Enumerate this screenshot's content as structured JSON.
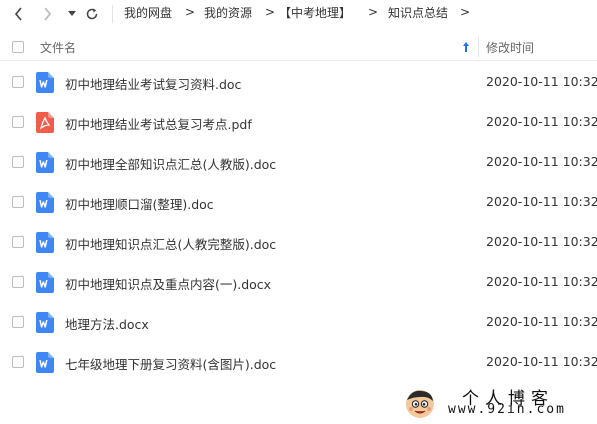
{
  "breadcrumb": {
    "items": [
      "我的网盘",
      "我的资源",
      "【中考地理】",
      "知识点总结"
    ],
    "separator": ">"
  },
  "table": {
    "name_header": "文件名",
    "time_header": "修改时间",
    "sort": "ascending",
    "rows": [
      {
        "name": "初中地理结业考试复习资料.doc",
        "type": "word",
        "time": "2020-10-11 10:32"
      },
      {
        "name": "初中地理结业考试总复习考点.pdf",
        "type": "pdf",
        "time": "2020-10-11 10:32"
      },
      {
        "name": "初中地理全部知识点汇总(人教版).doc",
        "type": "word",
        "time": "2020-10-11 10:32"
      },
      {
        "name": "初中地理顺口溜(整理).doc",
        "type": "word",
        "time": "2020-10-11 10:32"
      },
      {
        "name": "初中地理知识点汇总(人教完整版).doc",
        "type": "word",
        "time": "2020-10-11 10:32"
      },
      {
        "name": "初中地理知识点及重点内容(一).docx",
        "type": "word",
        "time": "2020-10-11 10:32"
      },
      {
        "name": "地理方法.docx",
        "type": "word",
        "time": "2020-10-11 10:32"
      },
      {
        "name": "七年级地理下册复习资料(含图片).doc",
        "type": "word",
        "time": "2020-10-11 10:32"
      }
    ]
  },
  "watermark": {
    "title": "个人博客",
    "url": "www.92in.com"
  },
  "colors": {
    "word": "#3f87f5",
    "pdf": "#f25c4a",
    "accent": "#1e6fff"
  },
  "icons": {
    "back": "chevron-left-icon",
    "forward": "chevron-right-icon",
    "history": "caret-down-icon",
    "refresh": "refresh-icon",
    "sort": "sort-up-arrow-icon"
  }
}
